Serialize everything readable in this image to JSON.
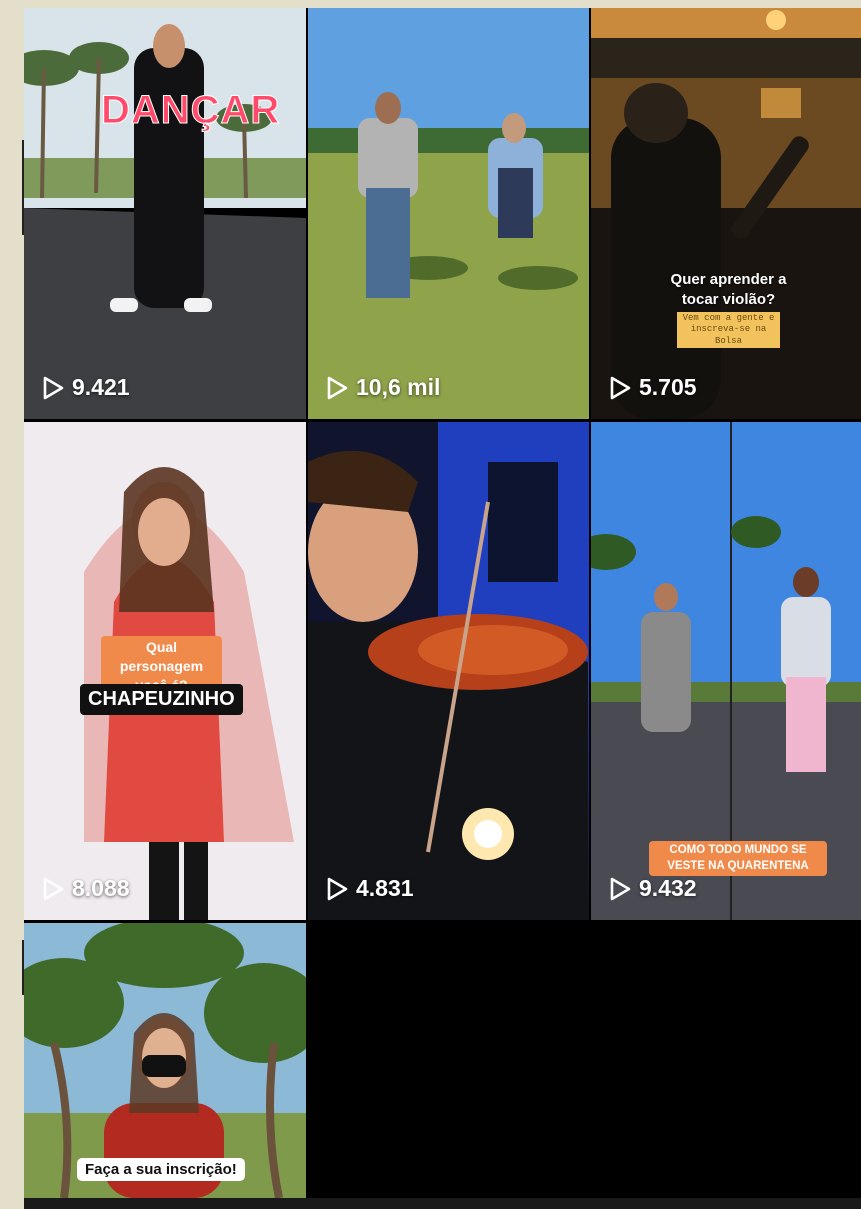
{
  "grid": {
    "tiles": [
      {
        "views": "9.421",
        "overlay_text": "DANÇAR"
      },
      {
        "views": "10,6 mil"
      },
      {
        "views": "5.705",
        "overlay_title": "Quer aprender a tocar violão?",
        "overlay_sub": "Vem com a gente e inscreva-se na Bolsa"
      },
      {
        "views": "8.088",
        "question": "Qual personagem você é?",
        "answer": "CHAPEUZINHO"
      },
      {
        "views": "4.831"
      },
      {
        "views": "9.432",
        "overlay_text": "COMO TODO MUNDO SE VESTE NA QUARENTENA"
      },
      {
        "overlay_text": "Faça a sua inscrição!"
      }
    ]
  },
  "colors": {
    "background": "#e3dfca",
    "grid_background": "#000000",
    "accent_orange": "#f08a4a",
    "accent_red": "#ff4a6a"
  },
  "icons": {
    "views": "play-icon"
  }
}
